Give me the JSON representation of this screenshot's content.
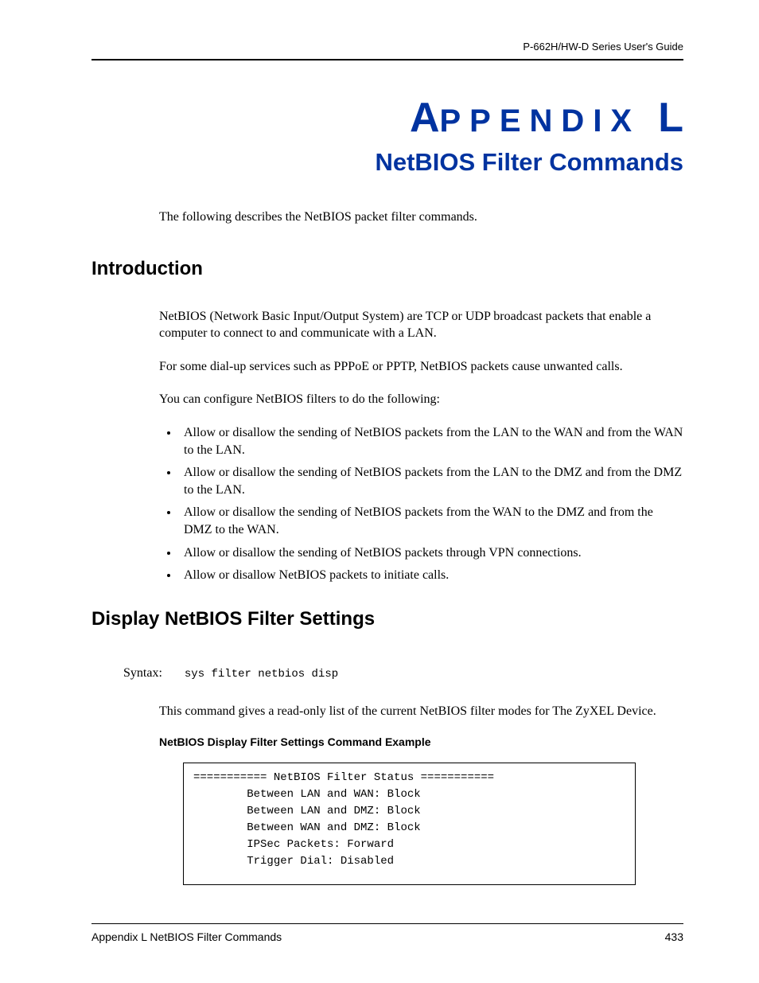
{
  "header": {
    "guideTitle": "P-662H/HW-D Series User's Guide"
  },
  "appendix": {
    "label": "PPENDIX",
    "letter": "L",
    "title": "NetBIOS Filter Commands"
  },
  "intro": "The following describes the NetBIOS packet filter commands.",
  "section1": {
    "heading": "Introduction",
    "para1": "NetBIOS (Network Basic Input/Output System) are TCP or UDP broadcast packets that enable a computer to connect to and communicate with a LAN.",
    "para2": "For some dial-up services such as PPPoE or PPTP, NetBIOS packets cause unwanted calls.",
    "para3": "You can configure NetBIOS filters to do the following:",
    "bullets": [
      "Allow or disallow the sending of NetBIOS packets from the LAN to the WAN and from the WAN to the LAN.",
      "Allow or disallow the sending of NetBIOS packets from the LAN to the DMZ and from the DMZ to the LAN.",
      "Allow or disallow the sending of NetBIOS packets from the WAN to the DMZ and from the DMZ to the WAN.",
      "Allow or disallow the sending of NetBIOS packets through VPN connections.",
      "Allow or disallow NetBIOS packets to initiate calls."
    ]
  },
  "section2": {
    "heading": "Display NetBIOS Filter Settings",
    "syntaxLabel": "Syntax:",
    "syntaxCommand": "sys filter netbios disp",
    "para1": "This command gives a read-only list of the current NetBIOS filter modes for The ZyXEL Device.",
    "exampleHeading": "NetBIOS Display Filter Settings Command Example",
    "codeExample": "=========== NetBIOS Filter Status ===========\n        Between LAN and WAN: Block\n        Between LAN and DMZ: Block\n        Between WAN and DMZ: Block\n        IPSec Packets: Forward\n        Trigger Dial: Disabled"
  },
  "footer": {
    "left": "Appendix L NetBIOS Filter Commands",
    "right": "433"
  }
}
